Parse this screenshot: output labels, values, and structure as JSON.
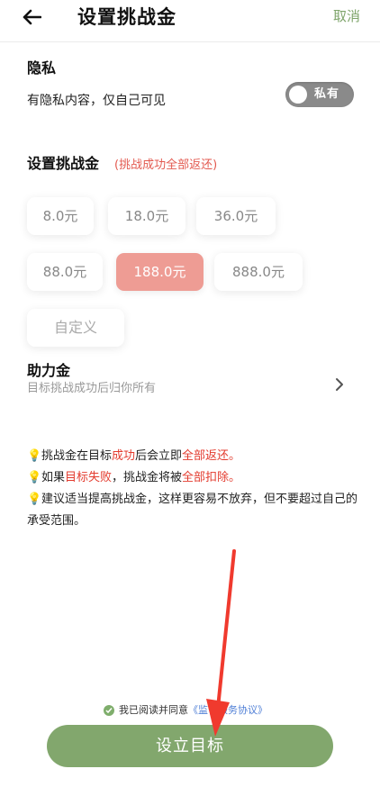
{
  "header": {
    "title": "设置挑战金",
    "cancel_label": "取消"
  },
  "privacy": {
    "title": "隐私",
    "description": "有隐私内容，仅自己可见",
    "toggle_label": "私有"
  },
  "challenge_money": {
    "title": "设置挑战金",
    "note": "(挑战成功全部返还)",
    "amounts": [
      "8.0元",
      "18.0元",
      "36.0元",
      "88.0元",
      "188.0元",
      "888.0元"
    ],
    "selected_index": 4,
    "custom_placeholder": "自定义"
  },
  "helper_money": {
    "title": "助力金",
    "subtitle": "目标挑战成功后归你所有"
  },
  "tips": [
    {
      "parts": [
        "挑战金在目标",
        "成功",
        "后会立即",
        "全部返还。"
      ]
    },
    {
      "parts": [
        "如果",
        "目标失败",
        "，挑战金将被",
        "全部扣除。"
      ]
    },
    {
      "text": "建议适当提高挑战金，这样更容易不放弃，但不要超过自己的承受范围。"
    }
  ],
  "agreement": {
    "prefix": "我已阅读并同意",
    "link": "《监督服务协议》"
  },
  "submit_label": "设立目标",
  "colors": {
    "accent_green": "#82a76d",
    "selected_amount": "#ee9c94",
    "warning_red": "#e33b2e",
    "link_blue": "#4f7fd6"
  }
}
